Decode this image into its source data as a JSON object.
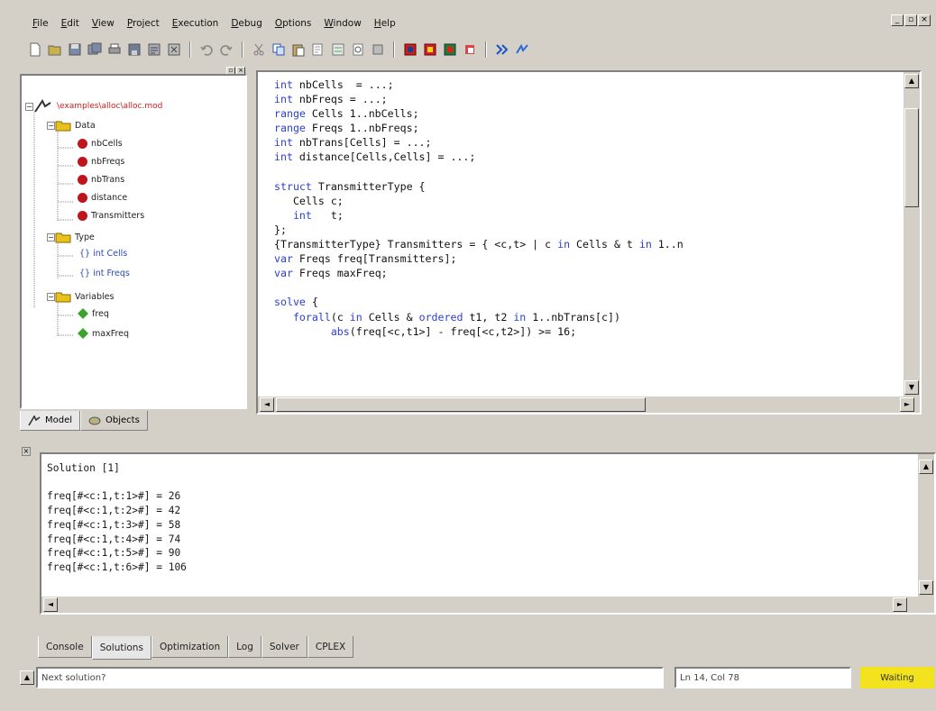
{
  "menubar": {
    "items": [
      "File",
      "Edit",
      "View",
      "Project",
      "Execution",
      "Debug",
      "Options",
      "Window",
      "Help"
    ]
  },
  "window_controls": {
    "minimize": "_",
    "restore": "▫",
    "close": "×"
  },
  "toolbar": {
    "icons": [
      "new-icon",
      "open-icon",
      "save-icon",
      "save-all-icon",
      "print-icon",
      "save-disk-icon",
      "properties-icon",
      "close-project-icon",
      "undo-icon",
      "redo-icon",
      "cut-icon",
      "copy-icon",
      "paste-icon",
      "find-icon",
      "replace-icon",
      "print-preview-icon",
      "stop-icon",
      "run-icon",
      "step-icon",
      "browse-icon",
      "watch-icon",
      "debug-icon",
      "go-icon",
      "forward-icon"
    ]
  },
  "project_tree": {
    "project_file": "\\examples\\alloc\\alloc.mod",
    "groups": [
      {
        "label": "Data",
        "items": [
          "nbCells",
          "nbFreqs",
          "nbTrans",
          "distance",
          "Transmitters"
        ]
      },
      {
        "label": "Type",
        "items": [
          "{} int Cells",
          "{} int Freqs"
        ]
      },
      {
        "label": "Variables",
        "items": [
          "freq",
          "maxFreq"
        ]
      }
    ]
  },
  "left_tabs": [
    "Model",
    "Objects"
  ],
  "editor": {
    "lines": [
      [
        {
          "k": 1,
          "t": "int"
        },
        {
          "k": 0,
          "t": " nbCells  = ...;"
        }
      ],
      [
        {
          "k": 1,
          "t": "int"
        },
        {
          "k": 0,
          "t": " nbFreqs = ...;"
        }
      ],
      [
        {
          "k": 1,
          "t": "range"
        },
        {
          "k": 0,
          "t": " Cells 1..nbCells;"
        }
      ],
      [
        {
          "k": 1,
          "t": "range"
        },
        {
          "k": 0,
          "t": " Freqs 1..nbFreqs;"
        }
      ],
      [
        {
          "k": 1,
          "t": "int"
        },
        {
          "k": 0,
          "t": " nbTrans[Cells] = ...;"
        }
      ],
      [
        {
          "k": 1,
          "t": "int"
        },
        {
          "k": 0,
          "t": " distance[Cells,Cells] = ...;"
        }
      ],
      [
        {
          "k": 0,
          "t": ""
        }
      ],
      [
        {
          "k": 1,
          "t": "struct"
        },
        {
          "k": 0,
          "t": " TransmitterType {"
        }
      ],
      [
        {
          "k": 0,
          "t": "   Cells c;"
        }
      ],
      [
        {
          "k": 0,
          "t": "   "
        },
        {
          "k": 1,
          "t": "int"
        },
        {
          "k": 0,
          "t": "   t;"
        }
      ],
      [
        {
          "k": 0,
          "t": "};"
        }
      ],
      [
        {
          "k": 0,
          "t": "{TransmitterType} Transmitters = { <c,t> | c "
        },
        {
          "k": 1,
          "t": "in"
        },
        {
          "k": 0,
          "t": " Cells & t "
        },
        {
          "k": 1,
          "t": "in"
        },
        {
          "k": 0,
          "t": " 1..n"
        }
      ],
      [
        {
          "k": 1,
          "t": "var"
        },
        {
          "k": 0,
          "t": " Freqs freq[Transmitters];"
        }
      ],
      [
        {
          "k": 1,
          "t": "var"
        },
        {
          "k": 0,
          "t": " Freqs maxFreq;"
        }
      ],
      [
        {
          "k": 0,
          "t": ""
        }
      ],
      [
        {
          "k": 1,
          "t": "solve"
        },
        {
          "k": 0,
          "t": " {"
        }
      ],
      [
        {
          "k": 0,
          "t": "   "
        },
        {
          "k": 1,
          "t": "forall"
        },
        {
          "k": 0,
          "t": "(c "
        },
        {
          "k": 1,
          "t": "in"
        },
        {
          "k": 0,
          "t": " Cells & "
        },
        {
          "k": 1,
          "t": "ordered"
        },
        {
          "k": 0,
          "t": " t1, t2 "
        },
        {
          "k": 1,
          "t": "in"
        },
        {
          "k": 0,
          "t": " 1..nbTrans[c])"
        }
      ],
      [
        {
          "k": 0,
          "t": "         "
        },
        {
          "k": 1,
          "t": "abs"
        },
        {
          "k": 0,
          "t": "(freq[<c,t1>] - freq[<c,t2>]) >= 16;"
        }
      ]
    ]
  },
  "output": {
    "header": "Solution [1]",
    "lines": [
      "freq[#<c:1,t:1>#] = 26",
      "freq[#<c:1,t:2>#] = 42",
      "freq[#<c:1,t:3>#] = 58",
      "freq[#<c:1,t:4>#] = 74",
      "freq[#<c:1,t:5>#] = 90",
      "freq[#<c:1,t:6>#] = 106"
    ]
  },
  "bottom_tabs": [
    "Console",
    "Solutions",
    "Optimization",
    "Log",
    "Solver",
    "CPLEX"
  ],
  "bottom_tabs_active": "Solutions",
  "status": {
    "message": "Next solution?",
    "position": "Ln 14, Col 78",
    "state": "Waiting"
  },
  "colors": {
    "keyword": "#2b3fd6",
    "data_node": "#c0141c",
    "variable_node": "#3aa52a",
    "folder": "#e8c21a",
    "status_badge": "#f3e21e",
    "project_file": "#d02020"
  }
}
